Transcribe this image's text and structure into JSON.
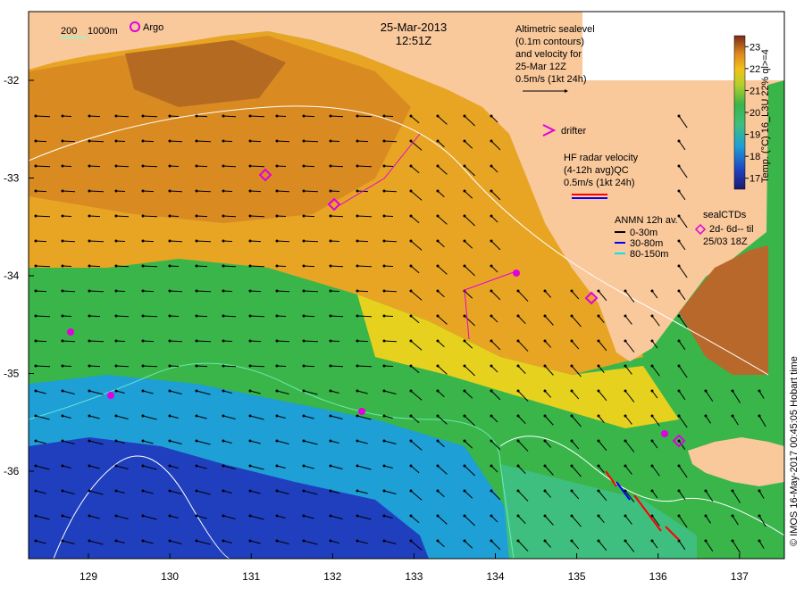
{
  "title": {
    "date": "25-Mar-2013",
    "time": "12:51Z"
  },
  "scale_legend": {
    "label_a": "200",
    "label_b": "1000m",
    "argo_label": "Argo"
  },
  "altimetry_note": {
    "line1": "Altimetric sealevel",
    "line2": "(0.1m contours)",
    "line3": "and velocity for",
    "line4": "25-Mar 12Z",
    "line5": "0.5m/s (1kt 24h)"
  },
  "drifter_label": "drifter",
  "hf_radar": {
    "line1": "HF radar velocity",
    "line2": "(4-12h avg)QC",
    "line3": "0.5m/s (1kt 24h)"
  },
  "anmn": {
    "title": "ANMN 12h av.",
    "items": [
      "0-30m",
      "30-80m",
      "80-150m"
    ],
    "colors": [
      "#000000",
      "#0000ff",
      "#00e5ee"
    ]
  },
  "sealctds": {
    "line1": "sealCTDs",
    "line2": "2d- 6d-- til",
    "line3": "25/03 18Z"
  },
  "colorbar": {
    "title": "Temp. (°C) 16_L3U 22% ql>=4",
    "ticks": [
      "17",
      "18",
      "19",
      "20",
      "21",
      "22",
      "23"
    ],
    "min": 16.5,
    "max": 23.5
  },
  "credit": "© IMOS 16-May-2017 00:45:05 Hobart time",
  "axes": {
    "lon_ticks": [
      "129",
      "130",
      "131",
      "132",
      "133",
      "134",
      "135",
      "136",
      "137"
    ],
    "lat_ticks": [
      "-32",
      "-33",
      "-34",
      "-35",
      "-36"
    ]
  },
  "colors": {
    "land": "#f9c89b",
    "white_box": "#ffffff",
    "argo": "#e000e0",
    "drifter": "#e000e0",
    "hf_arrow_red": "#ff0000",
    "hf_arrow_blue": "#0000ff"
  }
}
